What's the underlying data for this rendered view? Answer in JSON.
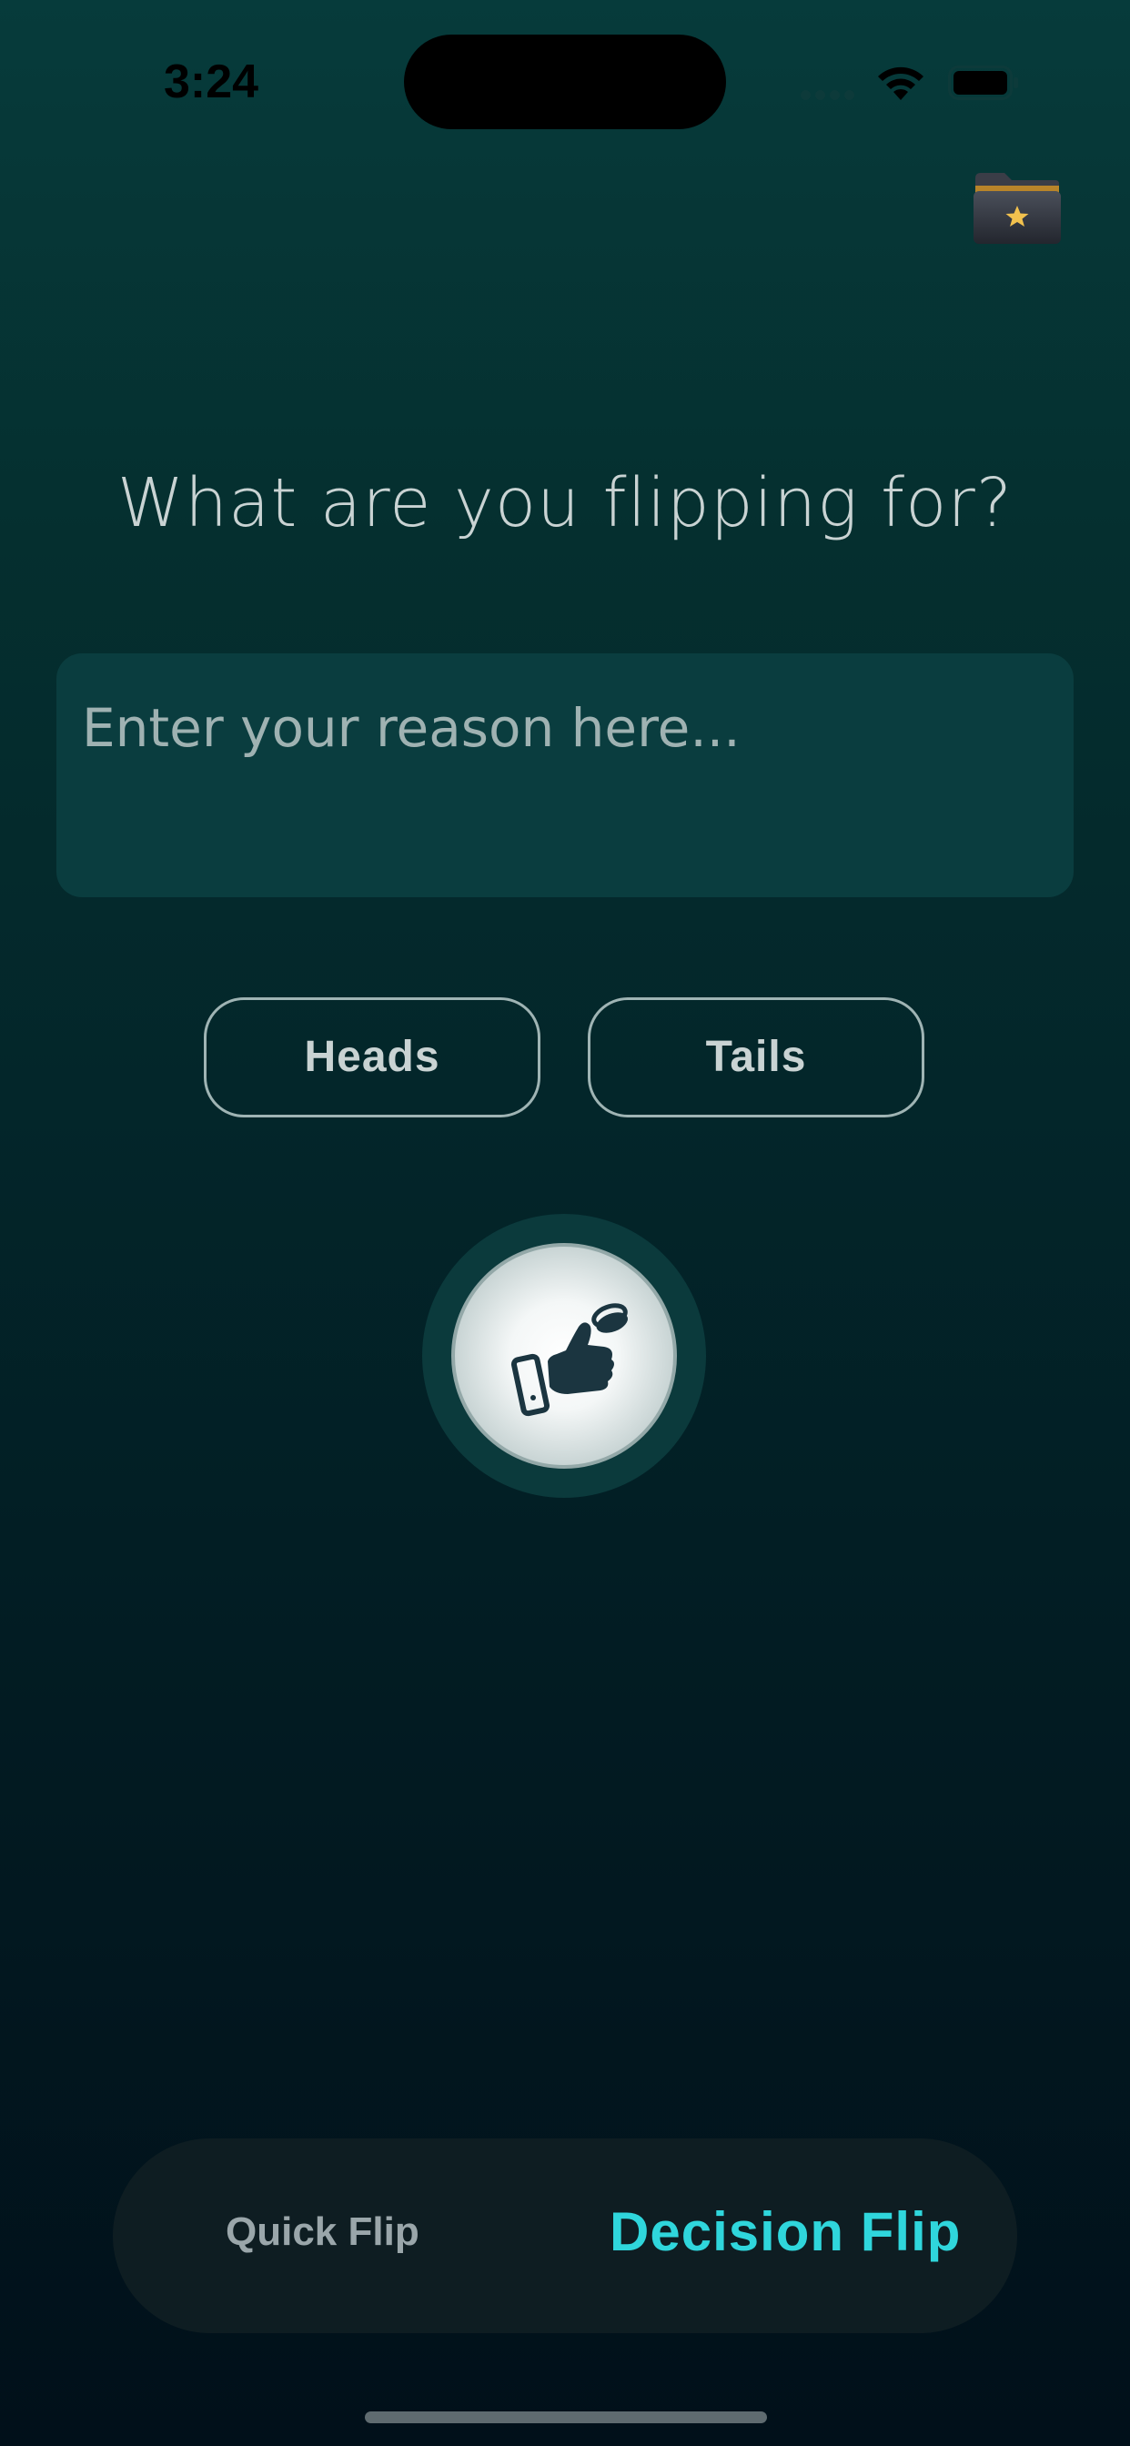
{
  "status_bar": {
    "time": "3:24"
  },
  "main": {
    "headline": "What are you flipping for?",
    "reason_placeholder": "Enter your reason here...",
    "reason_value": "",
    "choices": [
      {
        "label": "Heads"
      },
      {
        "label": "Tails"
      }
    ]
  },
  "mode_bar": {
    "quick_label": "Quick Flip",
    "decision_label": "Decision Flip",
    "active": "Decision Flip"
  },
  "icons": {
    "folder": "star-folder-icon",
    "flip": "thumb-flip-coin-icon",
    "wifi": "wifi-icon",
    "battery": "battery-icon"
  },
  "colors": {
    "accent": "#2fd6dc",
    "background_top": "#063b3b",
    "background_bottom": "#01101a",
    "input_bg": "#0a3d3f"
  }
}
